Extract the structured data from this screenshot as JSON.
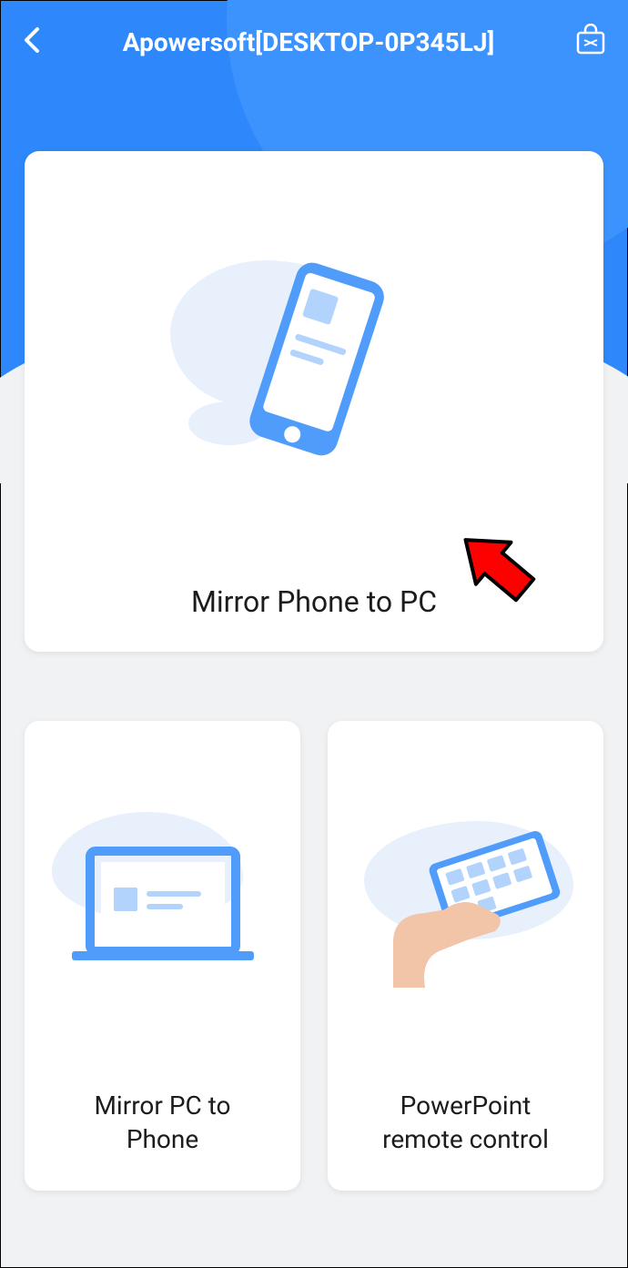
{
  "header": {
    "title": "Apowersoft[DESKTOP-0P345LJ]"
  },
  "main_card": {
    "title": "Mirror Phone to PC"
  },
  "cards": [
    {
      "title": "Mirror PC to\nPhone"
    },
    {
      "title": "PowerPoint\nremote control"
    }
  ]
}
